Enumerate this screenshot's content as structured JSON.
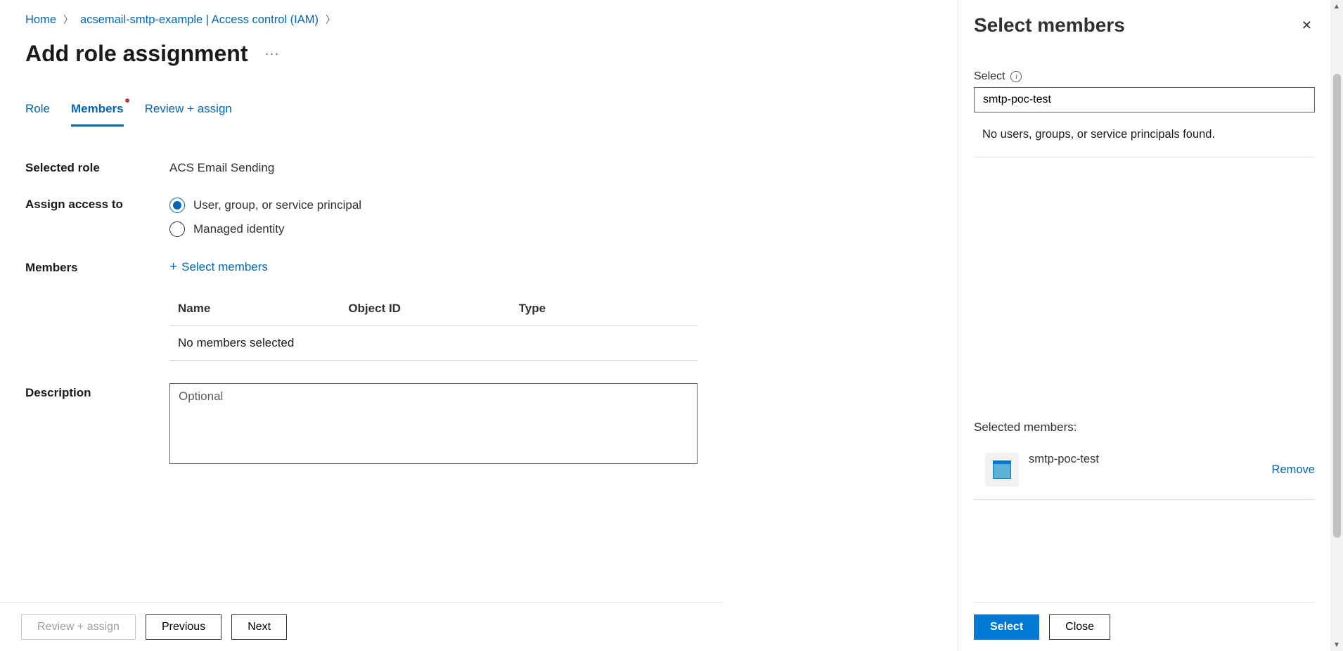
{
  "breadcrumb": {
    "home": "Home",
    "resource": "acsemail-smtp-example | Access control (IAM)"
  },
  "page_title": "Add role assignment",
  "tabs": {
    "role": "Role",
    "members": "Members",
    "review": "Review + assign"
  },
  "form": {
    "selected_role_label": "Selected role",
    "selected_role_value": "ACS Email Sending",
    "assign_access_label": "Assign access to",
    "assign_option_user": "User, group, or service principal",
    "assign_option_managed": "Managed identity",
    "members_label": "Members",
    "select_members_link": "Select members",
    "table": {
      "col_name": "Name",
      "col_object_id": "Object ID",
      "col_type": "Type",
      "empty_row": "No members selected"
    },
    "description_label": "Description",
    "description_placeholder": "Optional"
  },
  "footer_buttons": {
    "review": "Review + assign",
    "previous": "Previous",
    "next": "Next"
  },
  "panel": {
    "title": "Select members",
    "select_label": "Select",
    "search_value": "smtp-poc-test",
    "no_results": "No users, groups, or service principals found.",
    "selected_members_label": "Selected members:",
    "member_name": "smtp-poc-test",
    "remove_link": "Remove",
    "select_button": "Select",
    "close_button": "Close"
  }
}
